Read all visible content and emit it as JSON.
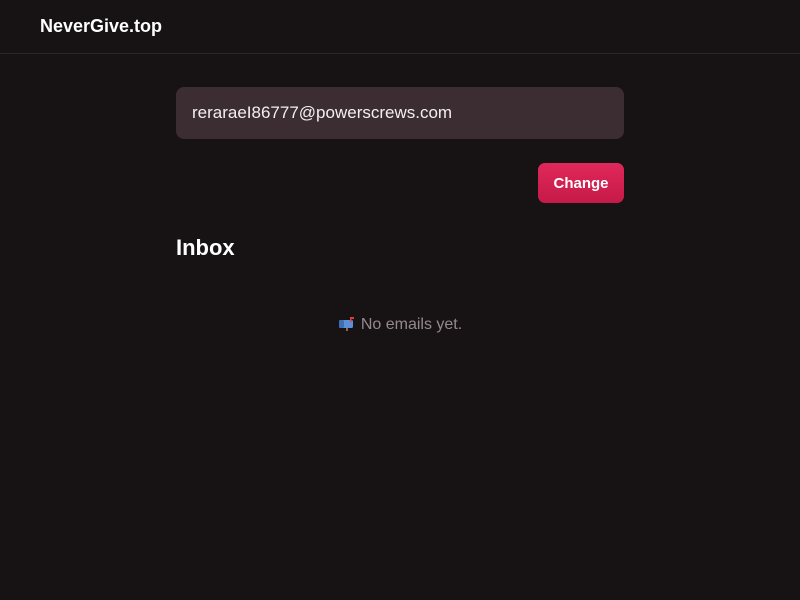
{
  "header": {
    "brand": "NeverGive.top"
  },
  "email": {
    "value": "reraraeI86777@powerscrews.com"
  },
  "actions": {
    "change_label": "Change"
  },
  "inbox": {
    "title": "Inbox",
    "empty_icon": "mailbox-icon",
    "empty_text": "No emails yet."
  },
  "colors": {
    "background": "#171214",
    "input_bg": "#3b2d31",
    "accent": "#d9224f",
    "muted_text": "#948a8e"
  }
}
